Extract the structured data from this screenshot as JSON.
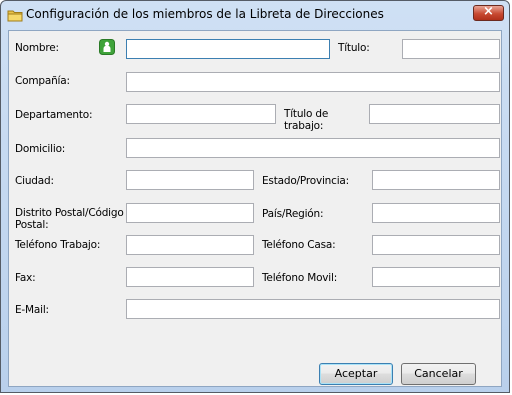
{
  "window": {
    "title": "Configuración de los miembros de la Libreta de Direcciones",
    "close_glyph": "×"
  },
  "fields": {
    "nombre": {
      "label": "Nombre:",
      "value": ""
    },
    "titulo": {
      "label": "Título:",
      "value": ""
    },
    "compania": {
      "label": "Compañía:",
      "value": ""
    },
    "departamento": {
      "label": "Departamento:",
      "value": ""
    },
    "titulo_trabajo": {
      "label": "Título de trabajo:",
      "value": ""
    },
    "domicilio": {
      "label": "Domicilio:",
      "value": ""
    },
    "ciudad": {
      "label": "Ciudad:",
      "value": ""
    },
    "estado": {
      "label": "Estado/Provincia:",
      "value": ""
    },
    "postal": {
      "label": "Distrito Postal/Código Postal:",
      "value": ""
    },
    "pais": {
      "label": "País/Región:",
      "value": ""
    },
    "tel_trabajo": {
      "label": "Teléfono Trabajo:",
      "value": ""
    },
    "tel_casa": {
      "label": "Teléfono Casa:",
      "value": ""
    },
    "fax": {
      "label": "Fax:",
      "value": ""
    },
    "tel_movil": {
      "label": "Teléfono Movil:",
      "value": ""
    },
    "email": {
      "label": "E-Mail:",
      "value": ""
    }
  },
  "buttons": {
    "accept": "Aceptar",
    "cancel": "Cancelar"
  },
  "colors": {
    "title_bar": "#c4d8f0",
    "close_button": "#c84a32",
    "focus_border": "#3c7fb1",
    "person_icon": "#3fa33a"
  }
}
